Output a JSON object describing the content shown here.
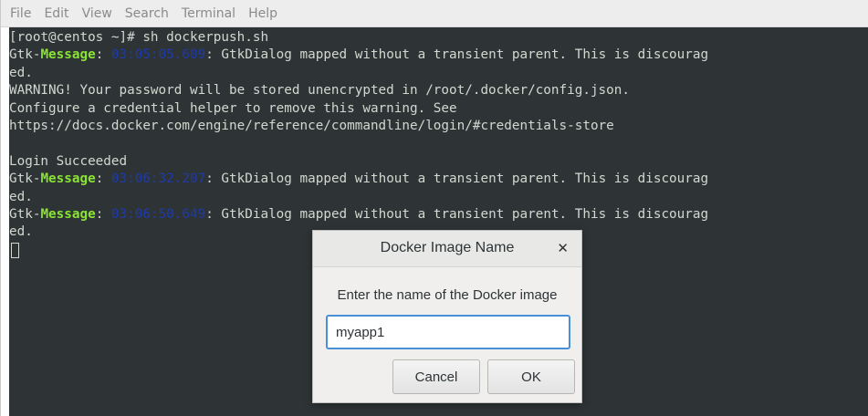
{
  "menubar": {
    "items": [
      "File",
      "Edit",
      "View",
      "Search",
      "Terminal",
      "Help"
    ]
  },
  "terminal": {
    "lines": [
      {
        "type": "plain",
        "text": "[root@centos ~]# sh dockerpush.sh"
      },
      {
        "type": "gtk",
        "prefix": "Gtk-",
        "label": "Message",
        "colon": ": ",
        "timestamp": "03:05:05.609",
        "rest": ": GtkDialog mapped without a transient parent. This is discourag"
      },
      {
        "type": "plain",
        "text": "ed."
      },
      {
        "type": "plain",
        "text": "WARNING! Your password will be stored unencrypted in /root/.docker/config.json."
      },
      {
        "type": "plain",
        "text": "Configure a credential helper to remove this warning. See"
      },
      {
        "type": "plain",
        "text": "https://docs.docker.com/engine/reference/commandline/login/#credentials-store"
      },
      {
        "type": "plain",
        "text": ""
      },
      {
        "type": "plain",
        "text": "Login Succeeded"
      },
      {
        "type": "gtk",
        "prefix": "Gtk-",
        "label": "Message",
        "colon": ": ",
        "timestamp": "03:06:32.207",
        "rest": ": GtkDialog mapped without a transient parent. This is discourag"
      },
      {
        "type": "plain",
        "text": "ed."
      },
      {
        "type": "gtk",
        "prefix": "Gtk-",
        "label": "Message",
        "colon": ": ",
        "timestamp": "03:06:50.649",
        "rest": ": GtkDialog mapped without a transient parent. This is discourag"
      },
      {
        "type": "plain",
        "text": "ed."
      }
    ],
    "colors": {
      "background": "#2e3436",
      "foreground": "#d3d7cf",
      "message_label": "#8ae234",
      "timestamp": "#1f3aa8"
    }
  },
  "dialog": {
    "title": "Docker Image Name",
    "prompt": "Enter the name of the Docker image",
    "input_value": "myapp1",
    "cancel_label": "Cancel",
    "ok_label": "OK"
  }
}
